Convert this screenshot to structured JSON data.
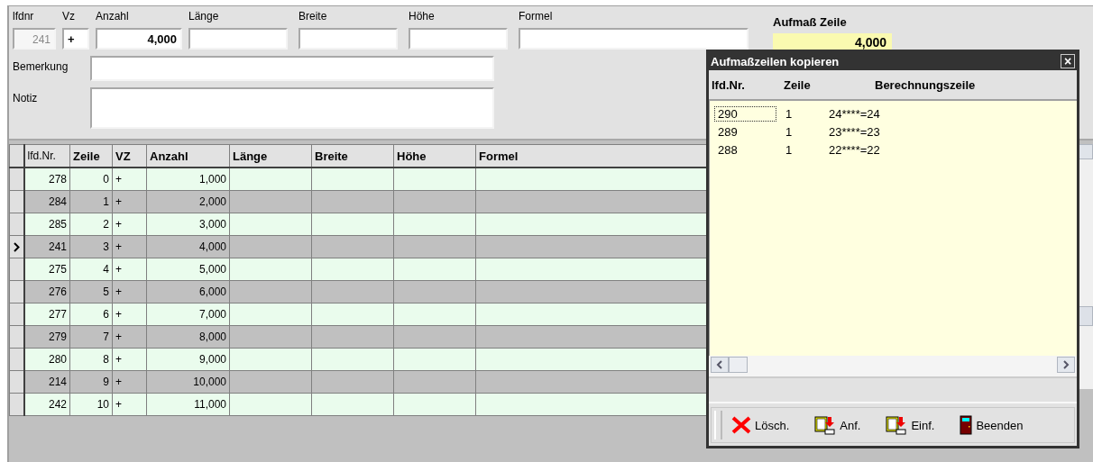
{
  "form": {
    "fields": [
      {
        "label": "lfdnr",
        "value": "241",
        "disabled": true,
        "bold": false
      },
      {
        "label": "Vz",
        "value": "+",
        "disabled": false,
        "bold": true
      },
      {
        "label": "Anzahl",
        "value": "4,000",
        "disabled": false,
        "bold": true
      },
      {
        "label": "Länge"
      },
      {
        "label": "Breite"
      },
      {
        "label": "Höhe"
      },
      {
        "label": "Formel"
      }
    ],
    "remark_label": "Bemerkung",
    "note_label": "Notiz",
    "total": {
      "label": "Aufmaß Zeile",
      "value": "4,000"
    }
  },
  "table": {
    "columns": [
      "lfd.Nr.",
      "Zeile",
      "VZ",
      "Anzahl",
      "Länge",
      "Breite",
      "Höhe",
      "Formel"
    ],
    "rows": [
      {
        "cells": [
          "278",
          "0",
          "+",
          "1,000"
        ],
        "selected": false
      },
      {
        "cells": [
          "284",
          "1",
          "+",
          "2,000"
        ],
        "selected": false
      },
      {
        "cells": [
          "285",
          "2",
          "+",
          "3,000"
        ],
        "selected": false
      },
      {
        "cells": [
          "241",
          "3",
          "+",
          "4,000"
        ],
        "selected": true
      },
      {
        "cells": [
          "275",
          "4",
          "+",
          "5,000"
        ],
        "selected": false
      },
      {
        "cells": [
          "276",
          "5",
          "+",
          "6,000"
        ],
        "selected": false
      },
      {
        "cells": [
          "277",
          "6",
          "+",
          "7,000"
        ],
        "selected": false
      },
      {
        "cells": [
          "279",
          "7",
          "+",
          "8,000"
        ],
        "selected": false
      },
      {
        "cells": [
          "280",
          "8",
          "+",
          "9,000"
        ],
        "selected": false
      },
      {
        "cells": [
          "214",
          "9",
          "+",
          "10,000"
        ],
        "selected": false
      },
      {
        "cells": [
          "242",
          "10",
          "+",
          "11,000"
        ],
        "selected": false
      }
    ]
  },
  "dialog": {
    "title": "Aufmaßzeilen kopieren",
    "close": "×",
    "columns": [
      "lfd.Nr.",
      "Zeile",
      "Berechnungszeile"
    ],
    "rows": [
      {
        "cells": [
          "290",
          "1",
          "24****=24"
        ],
        "selected": true
      },
      {
        "cells": [
          "289",
          "1",
          "23****=23"
        ],
        "selected": false
      },
      {
        "cells": [
          "288",
          "1",
          "22****=22"
        ],
        "selected": false
      }
    ],
    "buttons": [
      {
        "kind": "delete",
        "label": "Lösch."
      },
      {
        "kind": "append",
        "label": "Anf."
      },
      {
        "kind": "insert",
        "label": "Einf."
      },
      {
        "kind": "exit",
        "label": "Beenden"
      }
    ]
  }
}
